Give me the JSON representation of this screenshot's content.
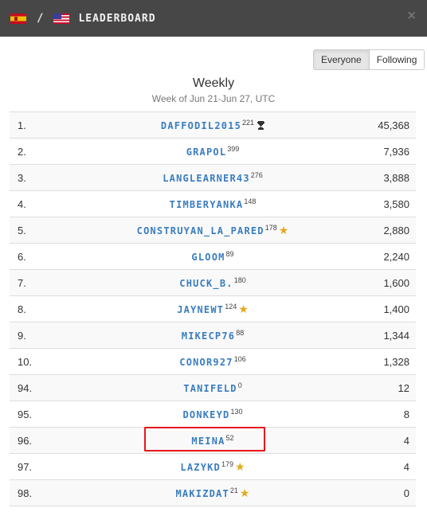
{
  "header": {
    "from_flag": "spain-flag",
    "to_flag": "usa-flag",
    "separator": "/",
    "title": "LEADERBOARD",
    "close_icon": "×"
  },
  "filter": {
    "options": [
      "Everyone",
      "Following"
    ],
    "selected": "Everyone"
  },
  "period": {
    "title": "Weekly",
    "subtitle": "Week of Jun 21-Jun 27, UTC"
  },
  "rows": [
    {
      "rank": "1.",
      "user": "DAFFODIL2015",
      "level": "221",
      "badge": "trophy",
      "score": "45,368"
    },
    {
      "rank": "2.",
      "user": "GRAPOL",
      "level": "399",
      "badge": "",
      "score": "7,936"
    },
    {
      "rank": "3.",
      "user": "LANGLEARNER43",
      "level": "276",
      "badge": "",
      "score": "3,888"
    },
    {
      "rank": "4.",
      "user": "TIMBERYANKA",
      "level": "148",
      "badge": "",
      "score": "3,580"
    },
    {
      "rank": "5.",
      "user": "CONSTRUYAN_LA_PARED",
      "level": "178",
      "badge": "star",
      "score": "2,880"
    },
    {
      "rank": "6.",
      "user": "GLOOM",
      "level": "89",
      "badge": "",
      "score": "2,240"
    },
    {
      "rank": "7.",
      "user": "CHUCK_B.",
      "level": "180",
      "badge": "",
      "score": "1,600"
    },
    {
      "rank": "8.",
      "user": "JAYNEWT",
      "level": "124",
      "badge": "star",
      "score": "1,400"
    },
    {
      "rank": "9.",
      "user": "MIKECP76",
      "level": "88",
      "badge": "",
      "score": "1,344"
    },
    {
      "rank": "10.",
      "user": "CONOR927",
      "level": "106",
      "badge": "",
      "score": "1,328"
    },
    {
      "rank": "94.",
      "user": "TANIFELD",
      "level": "0",
      "badge": "",
      "score": "12"
    },
    {
      "rank": "95.",
      "user": "DONKEYD",
      "level": "130",
      "badge": "",
      "score": "8"
    },
    {
      "rank": "96.",
      "user": "MEINA",
      "level": "52",
      "badge": "",
      "score": "4",
      "highlighted": true
    },
    {
      "rank": "97.",
      "user": "LAZYKD",
      "level": "179",
      "badge": "star",
      "score": "4"
    },
    {
      "rank": "98.",
      "user": "MAKIZDAT",
      "level": "21",
      "badge": "star",
      "score": "0"
    }
  ],
  "colors": {
    "header_bg": "#474747",
    "username": "#3a7dc0",
    "star": "#e3a91a",
    "highlight_box": "#e8161b"
  }
}
